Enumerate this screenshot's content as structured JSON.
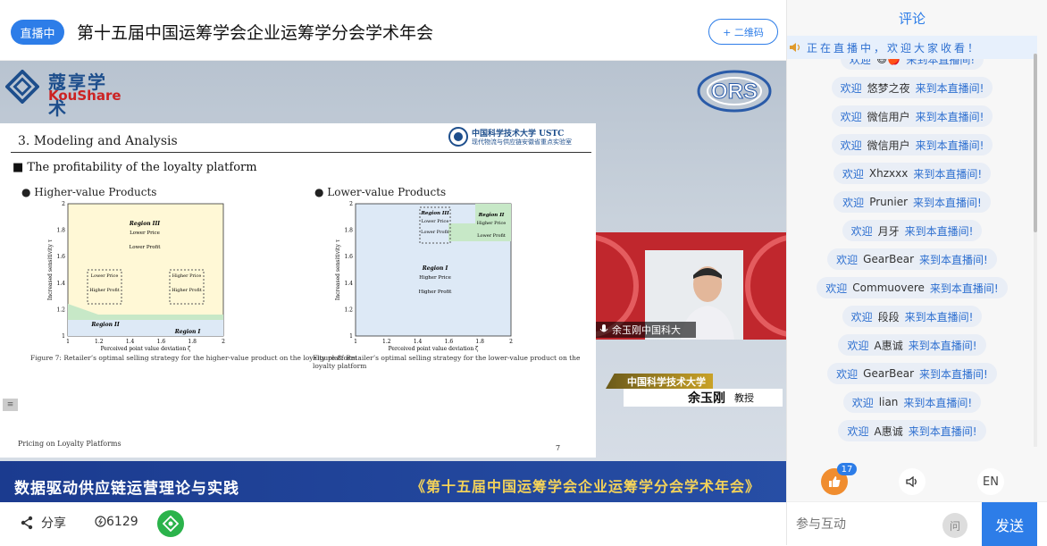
{
  "header": {
    "live_badge": "直播中",
    "title": "第十五届中国运筹学会企业运筹学分会学术年会",
    "qr_button": "+ 二维码"
  },
  "brand": {
    "cn": "蔻享学术",
    "en": "KouShare",
    "ors_logo": "ORS"
  },
  "slide": {
    "heading": "3. Modeling and Analysis",
    "org_logo_text": "中国科学技术大学 USTC",
    "org_logo_sub": "现代物流与供应链安徽省重点实验室",
    "bullet": "The profitability of the loyalty platform",
    "left_sub": "Higher-value Products",
    "right_sub": "Lower-value Products",
    "left_caption": "Figure 7: Retailer’s optimal selling strategy for the higher-value product on the loyalty platform",
    "right_caption": "Figure 8: Retailer’s optimal selling strategy for the lower-value product on the loyalty platform",
    "footer": "Pricing on Loyalty Platforms",
    "page": "7",
    "tool_icon": "≡",
    "left_fig": {
      "region3": "Region III",
      "region3_l1": "Lower Price",
      "region3_l2": "Lower Profit",
      "region2": "Region II",
      "region1": "Region I",
      "box_a1": "Lower Price",
      "box_a2": "Higher Profit",
      "box_b1": "Higher Price",
      "box_b2": "Higher Profit",
      "xlabel": "Perceived point value deviation ζ",
      "ylabel": "Increased sensitivity τ",
      "xticks": [
        "1",
        "1.2",
        "1.4",
        "1.6",
        "1.8",
        "2"
      ],
      "yticks": [
        "1",
        "1.2",
        "1.4",
        "1.6",
        "1.8",
        "2"
      ]
    },
    "right_fig": {
      "region1": "Region I",
      "region1_l1": "Higher Price",
      "region1_l2": "Higher Profit",
      "region2": "Region II",
      "region2_l1": "Higher Price",
      "region2_l2": "Lower Profit",
      "region3": "Region III",
      "region3_l1": "Lower Price",
      "region3_l2": "Lower Profit",
      "xlabel": "Perceived point value deviation ζ",
      "ylabel": "Increased sensitivity τ",
      "xticks": [
        "1",
        "1.2",
        "1.4",
        "1.6",
        "1.8",
        "2"
      ],
      "yticks": [
        "1",
        "1.2",
        "1.4",
        "1.6",
        "1.8",
        "2"
      ]
    }
  },
  "camera": {
    "name_tag": "余玉刚中国科大"
  },
  "name_plate": {
    "org": "中国科学技术大学",
    "name": "余玉刚",
    "role": "教授"
  },
  "banner": {
    "left": "数据驱动供应链运营理论与实践",
    "right": "《第十五届中国运筹学会企业运筹学分会学术年会》"
  },
  "footer": {
    "share": "分享",
    "views": "6129"
  },
  "comments": {
    "title": "评论",
    "notice": "正在直播中，欢迎大家收看！",
    "items": [
      {
        "user": "😃🍎",
        "pre": "欢迎",
        "post": "来到本直播间!"
      },
      {
        "user": "悠梦之夜",
        "pre": "欢迎",
        "post": "来到本直播间!"
      },
      {
        "user": "微信用户",
        "pre": "欢迎",
        "post": "来到本直播间!"
      },
      {
        "user": "微信用户",
        "pre": "欢迎",
        "post": "来到本直播间!"
      },
      {
        "user": "Xhzxxx",
        "pre": "欢迎",
        "post": "来到本直播间!"
      },
      {
        "user": "Prunier",
        "pre": "欢迎",
        "post": "来到本直播间!"
      },
      {
        "user": "月牙",
        "pre": "欢迎",
        "post": "来到本直播间!"
      },
      {
        "user": "GearBear",
        "pre": "欢迎",
        "post": "来到本直播间!"
      },
      {
        "user": "Commuovere",
        "pre": "欢迎",
        "post": "来到本直播间!"
      },
      {
        "user": "段段",
        "pre": "欢迎",
        "post": "来到本直播间!"
      },
      {
        "user": "A惠诚",
        "pre": "欢迎",
        "post": "来到本直播间!"
      },
      {
        "user": "GearBear",
        "pre": "欢迎",
        "post": "来到本直播间!"
      },
      {
        "user": "lian",
        "pre": "欢迎",
        "post": "来到本直播间!"
      },
      {
        "user": "A惠诚",
        "pre": "欢迎",
        "post": "来到本直播间!"
      }
    ]
  },
  "toolbar": {
    "like_count": "17",
    "lang": "EN"
  },
  "input": {
    "placeholder": "参与互动",
    "ask": "问",
    "send": "发送"
  }
}
